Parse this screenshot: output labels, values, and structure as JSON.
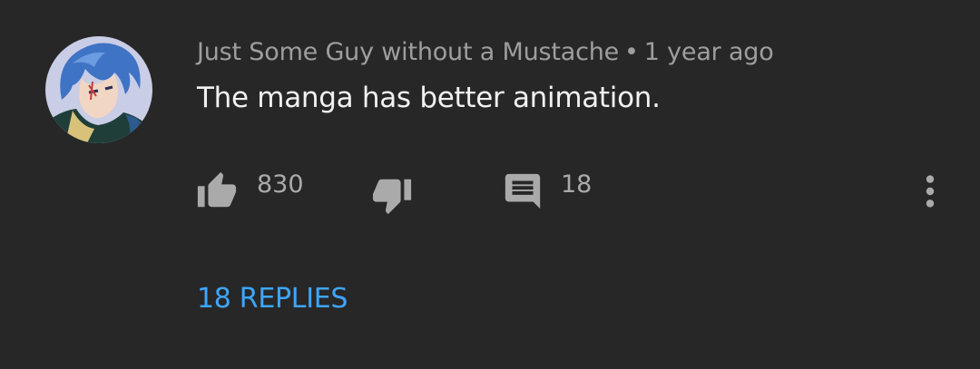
{
  "comment": {
    "author": "Just Some Guy without a Mustache",
    "separator": "•",
    "timestamp": "1 year ago",
    "text": "The manga has better animation.",
    "like_count": "830",
    "reply_count": "18",
    "replies_label": "18 REPLIES"
  },
  "icons": {
    "like": "thumb-up-icon",
    "dislike": "thumb-down-icon",
    "reply": "comment-icon",
    "more": "more-vert-icon"
  },
  "colors": {
    "background": "#272727",
    "author_text": "#9e9e9e",
    "body_text": "#f1f1f1",
    "icon": "#aaaaaa",
    "replies_link": "#3ea6ff"
  }
}
